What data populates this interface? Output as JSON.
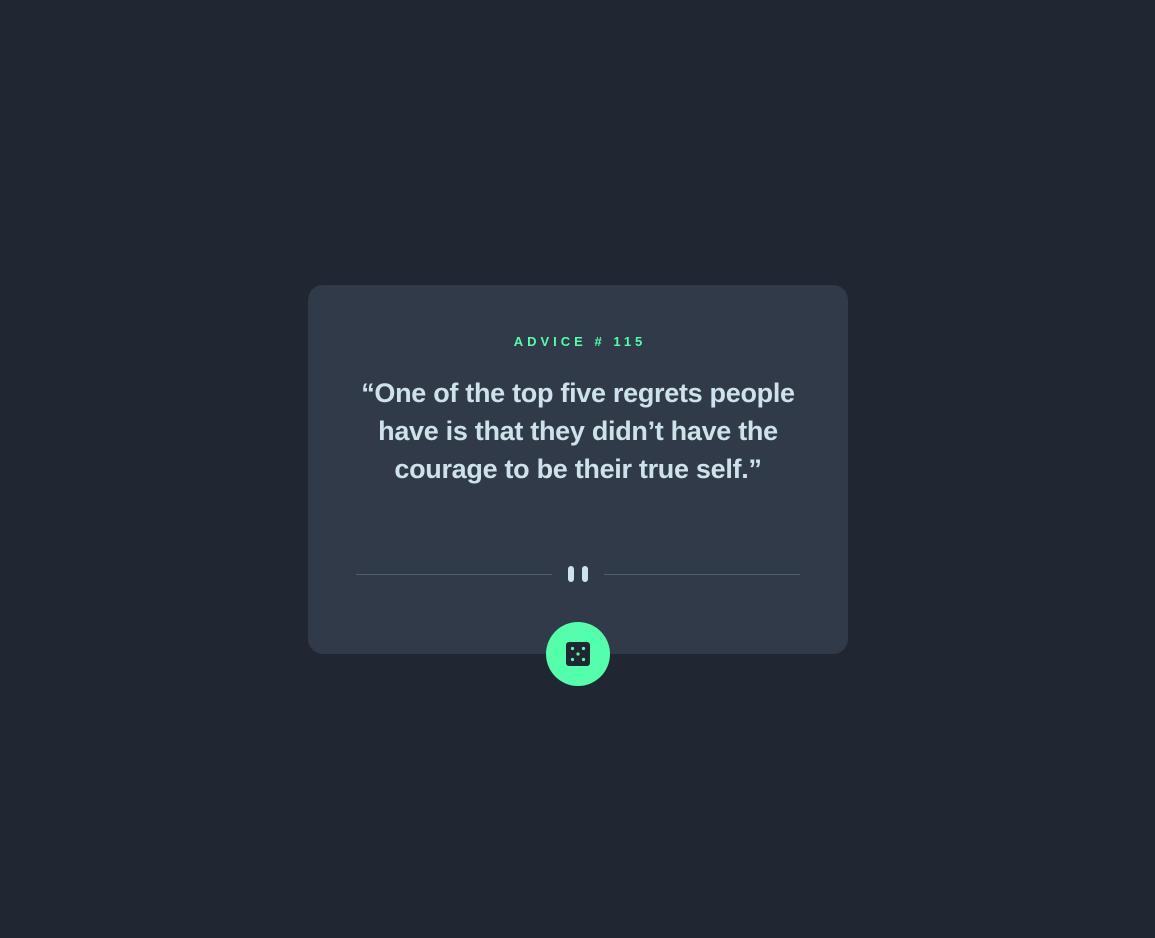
{
  "advice": {
    "label": "ADVICE",
    "hash": "#",
    "number": "115",
    "text": "“One of the top five regrets people have is that they didn’t have the courage to be their true self.”"
  },
  "icons": {
    "divider": "pause-icon",
    "button": "dice-icon"
  },
  "colors": {
    "background": "#202632",
    "card": "#313a48",
    "accent": "#53ffaa",
    "text": "#cee3e9",
    "divider": "#4f5d74"
  }
}
